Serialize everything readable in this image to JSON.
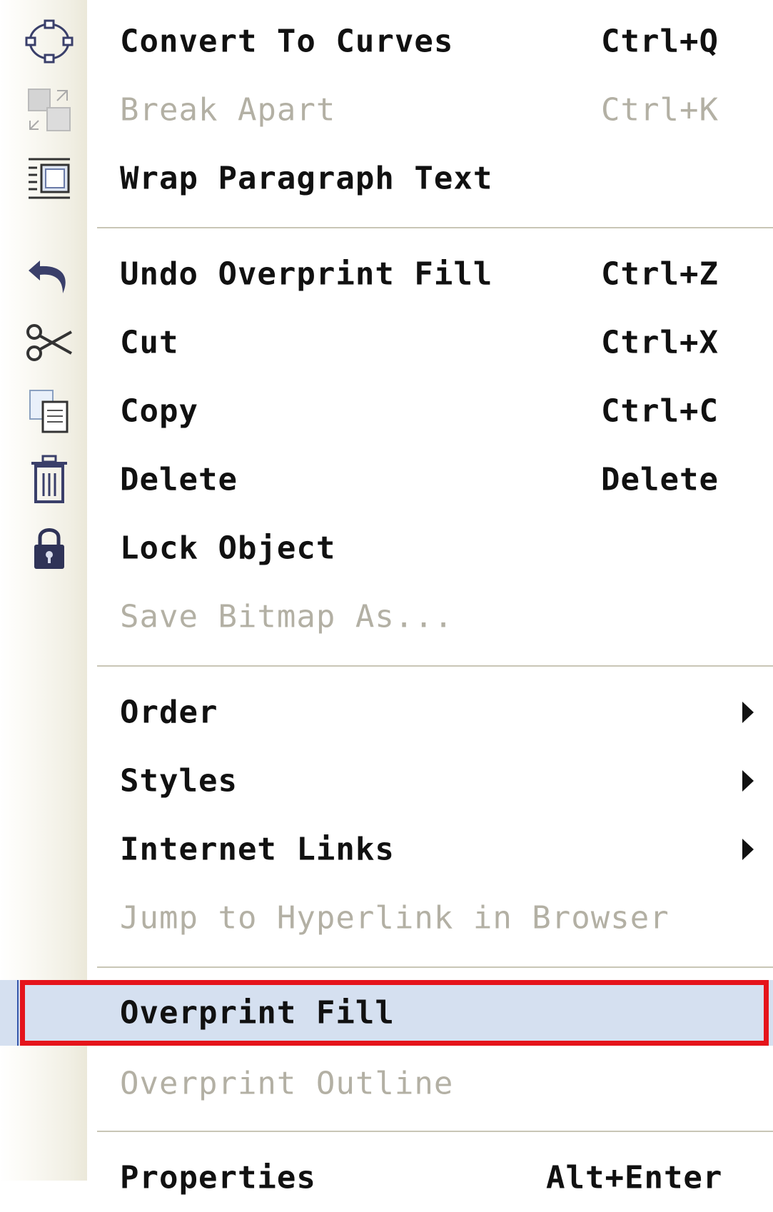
{
  "menu": {
    "items": [
      {
        "label": "Convert To Curves",
        "shortcut": "Ctrl+Q",
        "icon": "convert-to-curves-icon",
        "enabled": true
      },
      {
        "label": "Break  Apart",
        "shortcut": "Ctrl+K",
        "icon": "break-apart-icon",
        "enabled": false
      },
      {
        "label": "Wrap Paragraph Text",
        "shortcut": "",
        "icon": "wrap-paragraph-text-icon",
        "enabled": true
      },
      {
        "label": "Undo Overprint Fill",
        "shortcut": "Ctrl+Z",
        "icon": "undo-icon",
        "enabled": true
      },
      {
        "label": "Cut",
        "shortcut": "Ctrl+X",
        "icon": "scissors-icon",
        "enabled": true
      },
      {
        "label": "Copy",
        "shortcut": "Ctrl+C",
        "icon": "copy-icon",
        "enabled": true
      },
      {
        "label": "Delete",
        "shortcut": "Delete",
        "icon": "trash-icon",
        "enabled": true
      },
      {
        "label": "Lock Object",
        "shortcut": "",
        "icon": "lock-icon",
        "enabled": true
      },
      {
        "label": "Save Bitmap As...",
        "shortcut": "",
        "icon": "",
        "enabled": false
      },
      {
        "label": "Order",
        "shortcut": "",
        "submenu": true,
        "enabled": true
      },
      {
        "label": "Styles",
        "shortcut": "",
        "submenu": true,
        "enabled": true
      },
      {
        "label": "Internet Links",
        "shortcut": "",
        "submenu": true,
        "enabled": true
      },
      {
        "label": "Jump to Hyperlink in Browser",
        "shortcut": "",
        "enabled": false
      },
      {
        "label": "Overprint Fill",
        "shortcut": "",
        "enabled": true,
        "highlighted": true
      },
      {
        "label": "Overprint Outline",
        "shortcut": "",
        "enabled": false
      },
      {
        "label": "Properties",
        "shortcut": "Alt+Enter",
        "enabled": true
      }
    ]
  },
  "colors": {
    "highlight_background": "#d5e0f0",
    "annotation_box": "#e5141b",
    "disabled_text": "#b3b0a4",
    "gutter": "#ebe8d9"
  }
}
